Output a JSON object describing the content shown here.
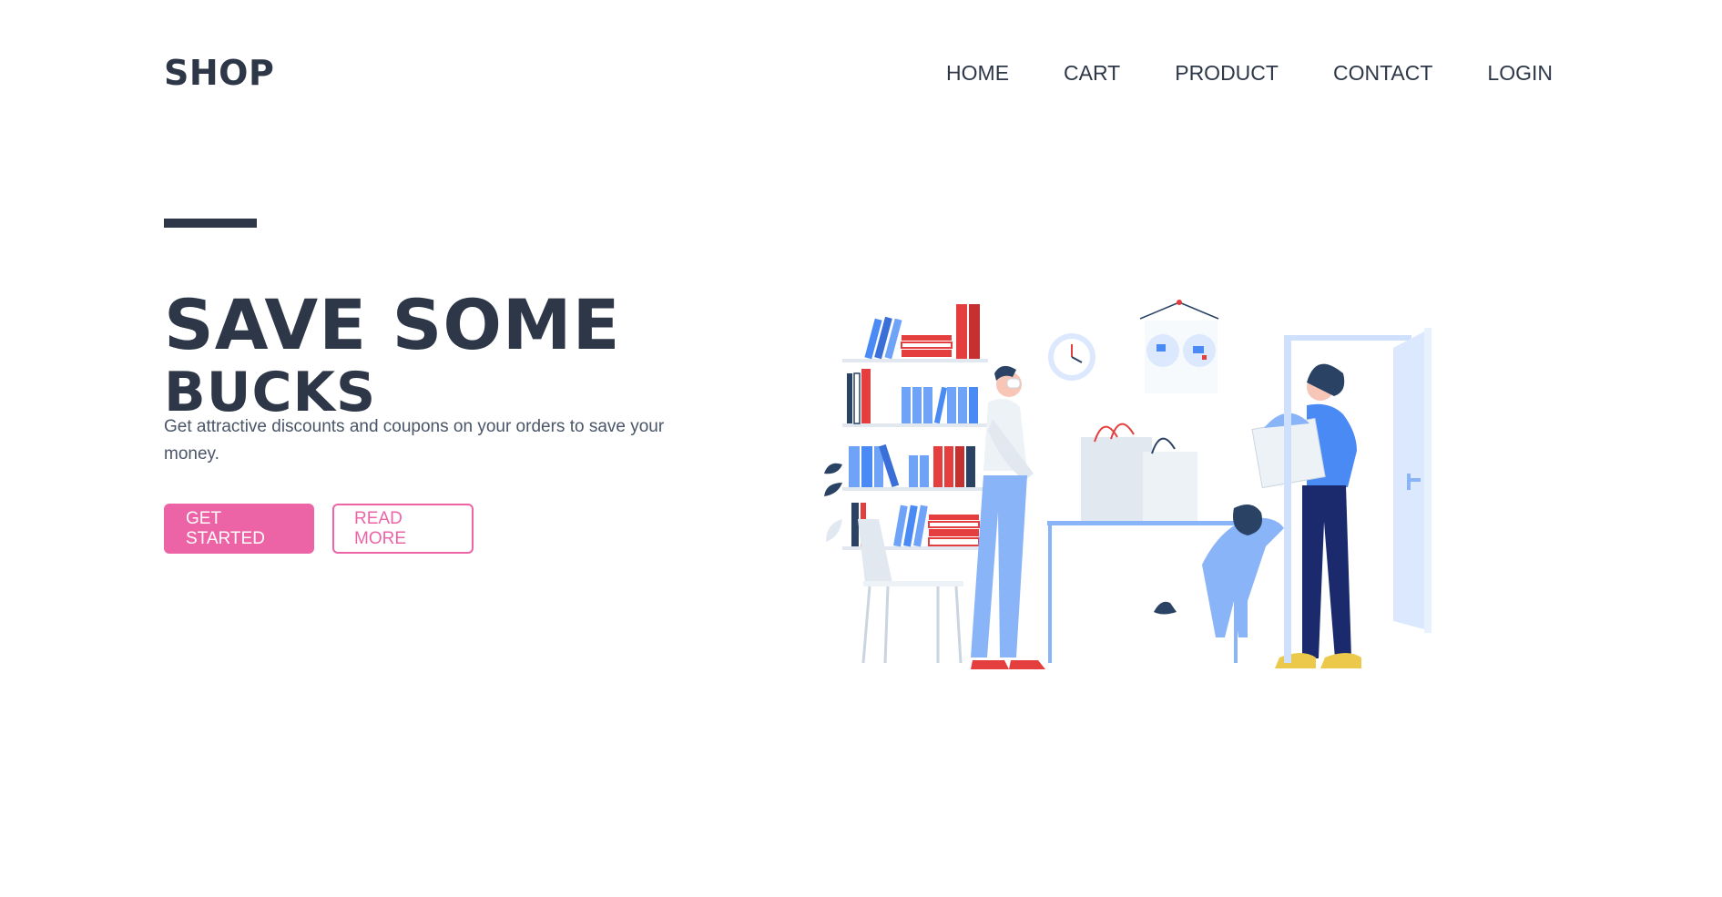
{
  "header": {
    "logo": "SHOP",
    "nav": [
      {
        "label": "HOME"
      },
      {
        "label": "CART"
      },
      {
        "label": "PRODUCT"
      },
      {
        "label": "CONTACT"
      },
      {
        "label": "LOGIN"
      }
    ]
  },
  "hero": {
    "title_line1": "SAVE SOME",
    "title_line2": "BUCKS",
    "description": "Get attractive discounts and coupons on your orders to save your money.",
    "primary_button": "GET STARTED",
    "secondary_button": "READ MORE"
  },
  "colors": {
    "text_dark": "#2d3748",
    "accent_pink": "#ed64a6",
    "illustration_blue": "#4a8af4",
    "illustration_red": "#e53e3e"
  },
  "icons": [
    "shop-illustration"
  ]
}
